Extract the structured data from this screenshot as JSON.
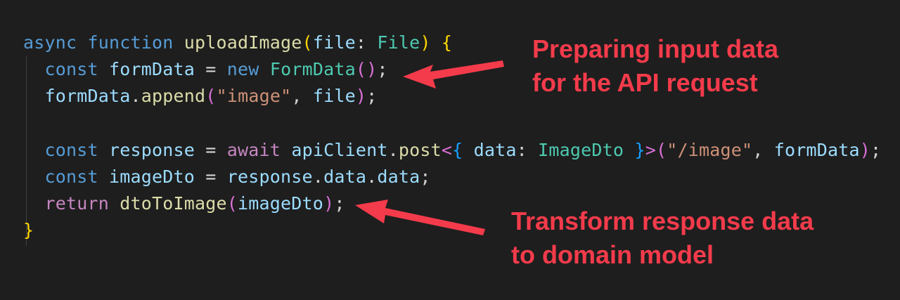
{
  "code_lines": [
    [
      [
        "async ",
        "kw"
      ],
      [
        "function ",
        "kw"
      ],
      [
        "uploadImage",
        "fn"
      ],
      [
        "(",
        "br"
      ],
      [
        "file",
        "var"
      ],
      [
        ": ",
        "pn"
      ],
      [
        "File",
        "ty"
      ],
      [
        ") ",
        "br"
      ],
      [
        "{",
        "br"
      ]
    ],
    [
      [
        "  const ",
        "kw"
      ],
      [
        "formData",
        "var"
      ],
      [
        " = ",
        "pn"
      ],
      [
        "new ",
        "kw"
      ],
      [
        "FormData",
        "ty"
      ],
      [
        "()",
        "br2"
      ],
      [
        ";",
        "pn"
      ]
    ],
    [
      [
        "  formData",
        "var"
      ],
      [
        ".",
        "pn"
      ],
      [
        "append",
        "fn"
      ],
      [
        "(",
        "br2"
      ],
      [
        "\"image\"",
        "str"
      ],
      [
        ", ",
        "pn"
      ],
      [
        "file",
        "var"
      ],
      [
        ")",
        "br2"
      ],
      [
        ";",
        "pn"
      ]
    ],
    [],
    [
      [
        "  const ",
        "kw"
      ],
      [
        "response",
        "var"
      ],
      [
        " = ",
        "pn"
      ],
      [
        "await ",
        "ctl"
      ],
      [
        "apiClient",
        "var"
      ],
      [
        ".",
        "pn"
      ],
      [
        "post",
        "fn"
      ],
      [
        "<",
        "br2"
      ],
      [
        "{ ",
        "br3"
      ],
      [
        "data",
        "var"
      ],
      [
        ": ",
        "pn"
      ],
      [
        "ImageDto",
        "ty"
      ],
      [
        " }",
        "br3"
      ],
      [
        ">",
        "br2"
      ],
      [
        "(",
        "br2"
      ],
      [
        "\"/image\"",
        "str"
      ],
      [
        ", ",
        "pn"
      ],
      [
        "formData",
        "var"
      ],
      [
        ")",
        "br2"
      ],
      [
        ";",
        "pn"
      ]
    ],
    [
      [
        "  const ",
        "kw"
      ],
      [
        "imageDto",
        "var"
      ],
      [
        " = ",
        "pn"
      ],
      [
        "response",
        "var"
      ],
      [
        ".",
        "pn"
      ],
      [
        "data",
        "var"
      ],
      [
        ".",
        "pn"
      ],
      [
        "data",
        "var"
      ],
      [
        ";",
        "pn"
      ]
    ],
    [
      [
        "  return ",
        "ctl"
      ],
      [
        "dtoToImage",
        "fn"
      ],
      [
        "(",
        "br2"
      ],
      [
        "imageDto",
        "var"
      ],
      [
        ")",
        "br2"
      ],
      [
        ";",
        "pn"
      ]
    ],
    [
      [
        "}",
        "br"
      ]
    ]
  ],
  "annotations": {
    "top": [
      "Preparing input data",
      "for the API request"
    ],
    "bottom": [
      "Transform response data",
      "to domain model"
    ]
  },
  "colors": {
    "annotation": "#f43b4b",
    "background": "#1e1e1e"
  }
}
